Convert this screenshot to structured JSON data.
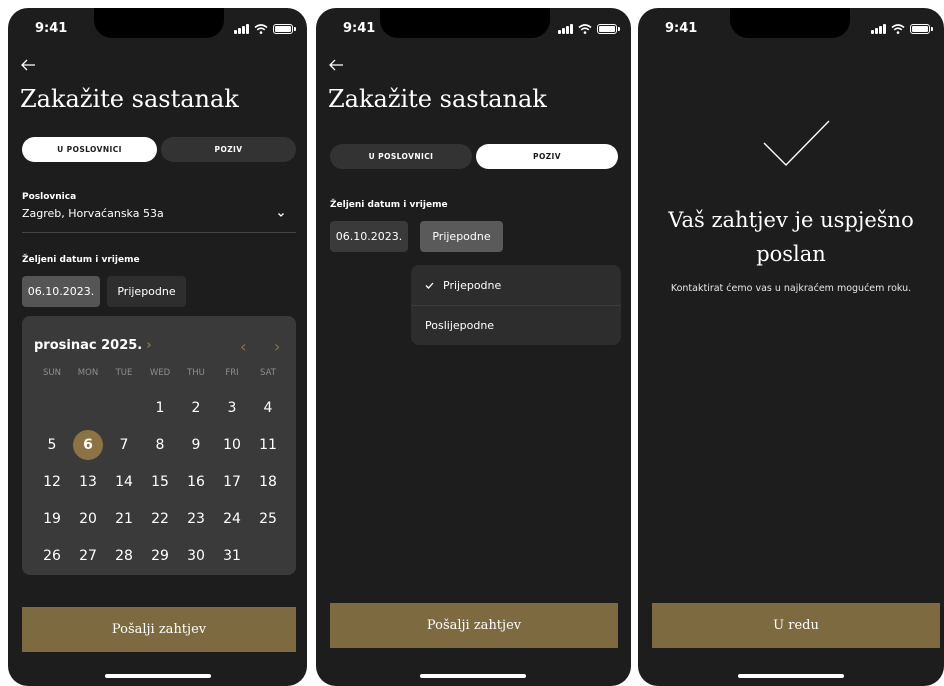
{
  "status": {
    "time": "9:41"
  },
  "form": {
    "title": "Zakažite sastanak",
    "segment": {
      "in_office": "U POSLOVNICI",
      "call": "POZIV"
    },
    "branch_label": "Poslovnica",
    "branch_value": "Zagreb, Horvaćanska 53a",
    "datetime_label": "Željeni datum i vrijeme",
    "date_value": "06.10.2023.",
    "period_value": "Prijepodne",
    "submit_label": "Pošalji zahtjev"
  },
  "calendar": {
    "month_title": "prosinac 2025.",
    "weekdays": [
      "SUN",
      "MON",
      "TUE",
      "WED",
      "THU",
      "FRI",
      "SAT"
    ],
    "leading_blanks": 3,
    "days_in_month": 31,
    "selected_day": 6
  },
  "dropdown": {
    "options": [
      "Prijepodne",
      "Poslijepodne"
    ],
    "selected": "Prijepodne"
  },
  "success": {
    "title": "Vaš zahtjev je uspješno poslan",
    "message": "Kontaktirat ćemo vas u najkraćem mogućem roku.",
    "button_label": "U redu"
  },
  "colors": {
    "background": "#1d1d1d",
    "accent": "#7e6a41",
    "accent_light": "#8c7343",
    "surface": "#3a3a3a"
  },
  "icons": [
    "back-arrow-icon",
    "chevron-down-icon",
    "chevron-left-icon",
    "chevron-right-icon",
    "checkmark-icon",
    "signal-icon",
    "wifi-icon",
    "battery-icon"
  ]
}
